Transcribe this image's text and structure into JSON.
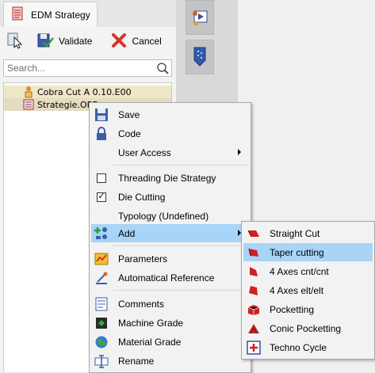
{
  "tab": {
    "label": "EDM Strategy"
  },
  "toolbar": {
    "validate_label": "Validate",
    "cancel_label": "Cancel"
  },
  "search": {
    "placeholder": "Search...",
    "icon": "magnifier-icon"
  },
  "tree": {
    "items": [
      {
        "label": "Cobra Cut A 0.10.E00"
      },
      {
        "label": "Strategie.OPE"
      }
    ]
  },
  "context_menu": {
    "items": [
      {
        "label": "Save",
        "icon": "save-icon"
      },
      {
        "label": "Code",
        "icon": "lock-icon"
      },
      {
        "label": "User Access",
        "has_submenu": true
      },
      {
        "label": "Threading Die Strategy",
        "checked": false
      },
      {
        "label": "Die Cutting",
        "checked": true
      },
      {
        "label": "Typology (Undefined)"
      },
      {
        "label": "Add",
        "icon": "add-icon",
        "has_submenu": true,
        "highlighted": true
      },
      {
        "label": "Parameters",
        "icon": "parameters-icon"
      },
      {
        "label": "Automatical Reference",
        "icon": "reference-icon"
      },
      {
        "label": "Comments",
        "icon": "comments-icon"
      },
      {
        "label": "Machine Grade",
        "icon": "machine-grade-icon"
      },
      {
        "label": "Material Grade",
        "icon": "material-grade-icon"
      },
      {
        "label": "Rename",
        "icon": "rename-icon"
      }
    ]
  },
  "add_submenu": {
    "items": [
      {
        "label": "Straight Cut",
        "icon": "straight-cut-icon"
      },
      {
        "label": "Taper cutting",
        "icon": "taper-cutting-icon",
        "highlighted": true
      },
      {
        "label": "4 Axes cnt/cnt",
        "icon": "four-axes-cnt-icon"
      },
      {
        "label": "4 Axes elt/elt",
        "icon": "four-axes-elt-icon"
      },
      {
        "label": "Pocketting",
        "icon": "pocketting-icon"
      },
      {
        "label": "Conic Pocketting",
        "icon": "conic-pocketting-icon"
      },
      {
        "label": "Techno Cycle",
        "icon": "techno-cycle-icon"
      }
    ]
  },
  "colors": {
    "highlight": "#a8d4f7",
    "tree_row_bg": "#efe6c8",
    "menu_bg": "#f2f2f2"
  }
}
